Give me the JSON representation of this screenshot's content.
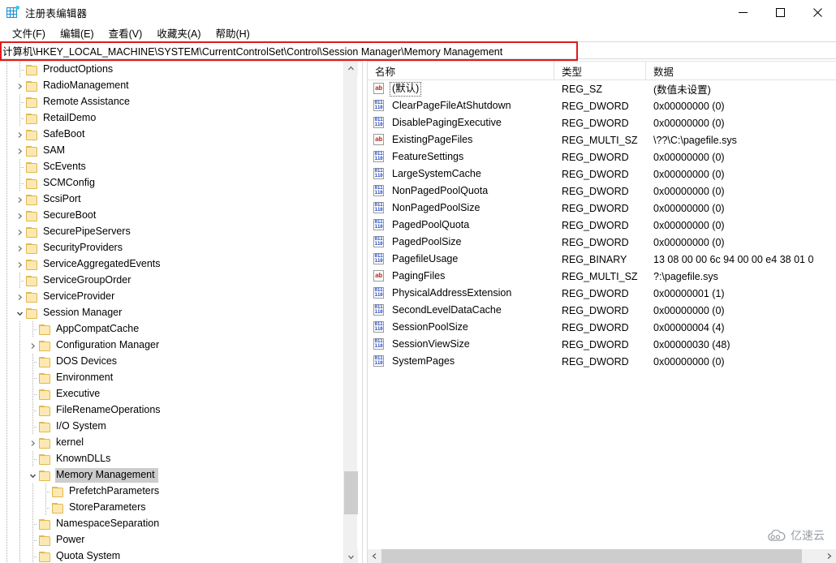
{
  "window": {
    "title": "注册表编辑器",
    "app_icon": "registry-editor-icon",
    "minimize_label": "—",
    "maximize_label": "□",
    "close_label": "✕"
  },
  "menubar": {
    "items": [
      {
        "label": "文件(F)"
      },
      {
        "label": "编辑(E)"
      },
      {
        "label": "查看(V)"
      },
      {
        "label": "收藏夹(A)"
      },
      {
        "label": "帮助(H)"
      }
    ]
  },
  "address": {
    "path": "计算机\\HKEY_LOCAL_MACHINE\\SYSTEM\\CurrentControlSet\\Control\\Session Manager\\Memory Management",
    "highlight_color": "#e01b1b"
  },
  "tree": {
    "items": [
      {
        "label": "ProductOptions",
        "depth": 2,
        "expander": "none",
        "selected": false
      },
      {
        "label": "RadioManagement",
        "depth": 2,
        "expander": "collapsed",
        "selected": false
      },
      {
        "label": "Remote Assistance",
        "depth": 2,
        "expander": "none",
        "selected": false
      },
      {
        "label": "RetailDemo",
        "depth": 2,
        "expander": "none",
        "selected": false
      },
      {
        "label": "SafeBoot",
        "depth": 2,
        "expander": "collapsed",
        "selected": false
      },
      {
        "label": "SAM",
        "depth": 2,
        "expander": "collapsed",
        "selected": false
      },
      {
        "label": "ScEvents",
        "depth": 2,
        "expander": "none",
        "selected": false
      },
      {
        "label": "SCMConfig",
        "depth": 2,
        "expander": "none",
        "selected": false
      },
      {
        "label": "ScsiPort",
        "depth": 2,
        "expander": "collapsed",
        "selected": false
      },
      {
        "label": "SecureBoot",
        "depth": 2,
        "expander": "collapsed",
        "selected": false
      },
      {
        "label": "SecurePipeServers",
        "depth": 2,
        "expander": "collapsed",
        "selected": false
      },
      {
        "label": "SecurityProviders",
        "depth": 2,
        "expander": "collapsed",
        "selected": false
      },
      {
        "label": "ServiceAggregatedEvents",
        "depth": 2,
        "expander": "collapsed",
        "selected": false
      },
      {
        "label": "ServiceGroupOrder",
        "depth": 2,
        "expander": "none",
        "selected": false
      },
      {
        "label": "ServiceProvider",
        "depth": 2,
        "expander": "collapsed",
        "selected": false
      },
      {
        "label": "Session Manager",
        "depth": 2,
        "expander": "expanded",
        "selected": false
      },
      {
        "label": "AppCompatCache",
        "depth": 3,
        "expander": "none",
        "selected": false
      },
      {
        "label": "Configuration Manager",
        "depth": 3,
        "expander": "collapsed",
        "selected": false
      },
      {
        "label": "DOS Devices",
        "depth": 3,
        "expander": "none",
        "selected": false
      },
      {
        "label": "Environment",
        "depth": 3,
        "expander": "none",
        "selected": false
      },
      {
        "label": "Executive",
        "depth": 3,
        "expander": "none",
        "selected": false
      },
      {
        "label": "FileRenameOperations",
        "depth": 3,
        "expander": "none",
        "selected": false
      },
      {
        "label": "I/O System",
        "depth": 3,
        "expander": "none",
        "selected": false
      },
      {
        "label": "kernel",
        "depth": 3,
        "expander": "collapsed",
        "selected": false
      },
      {
        "label": "KnownDLLs",
        "depth": 3,
        "expander": "none",
        "selected": false
      },
      {
        "label": "Memory Management",
        "depth": 3,
        "expander": "expanded",
        "selected": true
      },
      {
        "label": "PrefetchParameters",
        "depth": 4,
        "expander": "none",
        "selected": false
      },
      {
        "label": "StoreParameters",
        "depth": 4,
        "expander": "none",
        "selected": false
      },
      {
        "label": "NamespaceSeparation",
        "depth": 3,
        "expander": "none",
        "selected": false
      },
      {
        "label": "Power",
        "depth": 3,
        "expander": "none",
        "selected": false
      },
      {
        "label": "Quota System",
        "depth": 3,
        "expander": "none",
        "selected": false
      }
    ]
  },
  "list": {
    "columns": {
      "name": "名称",
      "type": "类型",
      "data": "数据"
    },
    "rows": [
      {
        "name": "(默认)",
        "type": "REG_SZ",
        "data": "(数值未设置)",
        "icon": "string-value-icon",
        "focused": true
      },
      {
        "name": "ClearPageFileAtShutdown",
        "type": "REG_DWORD",
        "data": "0x00000000 (0)",
        "icon": "dword-value-icon",
        "focused": false
      },
      {
        "name": "DisablePagingExecutive",
        "type": "REG_DWORD",
        "data": "0x00000000 (0)",
        "icon": "dword-value-icon",
        "focused": false
      },
      {
        "name": "ExistingPageFiles",
        "type": "REG_MULTI_SZ",
        "data": "\\??\\C:\\pagefile.sys",
        "icon": "string-value-icon",
        "focused": false
      },
      {
        "name": "FeatureSettings",
        "type": "REG_DWORD",
        "data": "0x00000000 (0)",
        "icon": "dword-value-icon",
        "focused": false
      },
      {
        "name": "LargeSystemCache",
        "type": "REG_DWORD",
        "data": "0x00000000 (0)",
        "icon": "dword-value-icon",
        "focused": false
      },
      {
        "name": "NonPagedPoolQuota",
        "type": "REG_DWORD",
        "data": "0x00000000 (0)",
        "icon": "dword-value-icon",
        "focused": false
      },
      {
        "name": "NonPagedPoolSize",
        "type": "REG_DWORD",
        "data": "0x00000000 (0)",
        "icon": "dword-value-icon",
        "focused": false
      },
      {
        "name": "PagedPoolQuota",
        "type": "REG_DWORD",
        "data": "0x00000000 (0)",
        "icon": "dword-value-icon",
        "focused": false
      },
      {
        "name": "PagedPoolSize",
        "type": "REG_DWORD",
        "data": "0x00000000 (0)",
        "icon": "dword-value-icon",
        "focused": false
      },
      {
        "name": "PagefileUsage",
        "type": "REG_BINARY",
        "data": "13 08 00 00 6c 94 00 00 e4 38 01 0",
        "icon": "binary-value-icon",
        "focused": false
      },
      {
        "name": "PagingFiles",
        "type": "REG_MULTI_SZ",
        "data": "?:\\pagefile.sys",
        "icon": "string-value-icon",
        "focused": false
      },
      {
        "name": "PhysicalAddressExtension",
        "type": "REG_DWORD",
        "data": "0x00000001 (1)",
        "icon": "dword-value-icon",
        "focused": false
      },
      {
        "name": "SecondLevelDataCache",
        "type": "REG_DWORD",
        "data": "0x00000000 (0)",
        "icon": "dword-value-icon",
        "focused": false
      },
      {
        "name": "SessionPoolSize",
        "type": "REG_DWORD",
        "data": "0x00000004 (4)",
        "icon": "dword-value-icon",
        "focused": false
      },
      {
        "name": "SessionViewSize",
        "type": "REG_DWORD",
        "data": "0x00000030 (48)",
        "icon": "dword-value-icon",
        "focused": false
      },
      {
        "name": "SystemPages",
        "type": "REG_DWORD",
        "data": "0x00000000 (0)",
        "icon": "dword-value-icon",
        "focused": false
      }
    ]
  },
  "watermark": {
    "text": "亿速云"
  }
}
